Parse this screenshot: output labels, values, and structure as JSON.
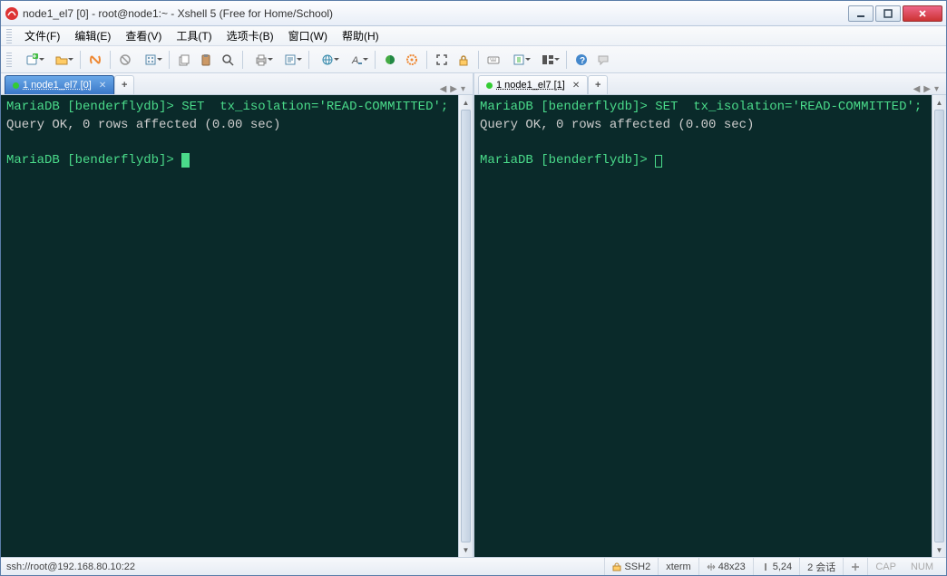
{
  "title": "node1_el7 [0] - root@node1:~ - Xshell 5 (Free for Home/School)",
  "menu": [
    "文件(F)",
    "编辑(E)",
    "查看(V)",
    "工具(T)",
    "选项卡(B)",
    "窗口(W)",
    "帮助(H)"
  ],
  "panes": [
    {
      "tab": {
        "label": "1 node1_el7 [0]",
        "active": true
      },
      "lines": [
        {
          "prompt": "MariaDB [benderflydb]> ",
          "cmd": "SET  tx_isolation='READ-COMMITTED';"
        },
        {
          "resp": "Query OK, 0 rows affected (0.00 sec)"
        },
        {
          "blank": true
        },
        {
          "prompt": "MariaDB [benderflydb]> ",
          "cursor": "block"
        }
      ]
    },
    {
      "tab": {
        "label": "1 node1_el7 [1]",
        "active": false
      },
      "lines": [
        {
          "prompt": "MariaDB [benderflydb]> ",
          "cmd": "SET  tx_isolation='READ-COMMITTED';"
        },
        {
          "resp": "Query OK, 0 rows affected (0.00 sec)"
        },
        {
          "blank": true
        },
        {
          "prompt": "MariaDB [benderflydb]> ",
          "cursor": "hollow"
        }
      ]
    }
  ],
  "status": {
    "conn": "ssh://root@192.168.80.10:22",
    "proto": "SSH2",
    "term": "xterm",
    "size": "48x23",
    "pos": "5,24",
    "sess": "2 会话",
    "lock_icon": true,
    "arrows_icon": true,
    "caret_icon": true,
    "cap": "CAP",
    "num": "NUM"
  }
}
